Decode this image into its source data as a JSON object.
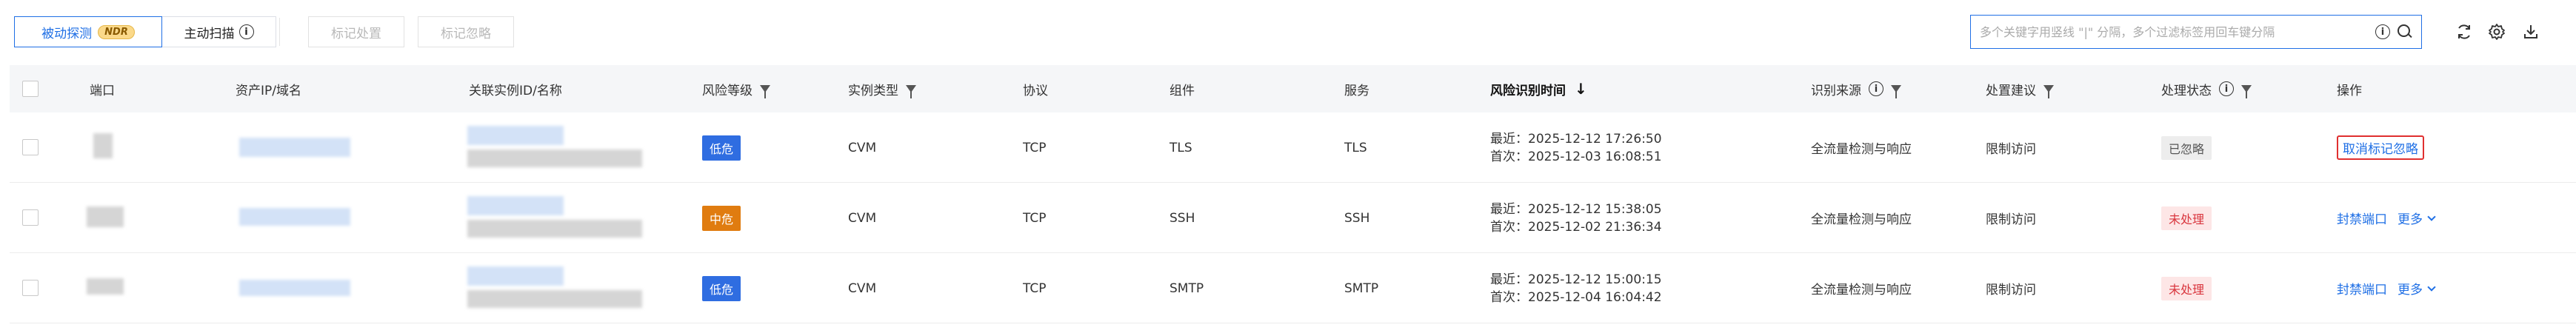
{
  "toolbar": {
    "tab_passive": "被动探测",
    "tab_passive_badge": "NDR",
    "tab_active": "主动扫描",
    "btn_mark_handle": "标记处置",
    "btn_mark_ignore": "标记忽略",
    "search_placeholder": "多个关键字用竖线 \"|\" 分隔，多个过滤标签用回车键分隔",
    "icons": [
      "info-icon",
      "search-icon",
      "refresh-icon",
      "gear-icon",
      "download-icon"
    ]
  },
  "table": {
    "columns": {
      "port": "端口",
      "asset": "资产IP/域名",
      "instance": "关联实例ID/名称",
      "risk": "风险等级",
      "instance_type": "实例类型",
      "protocol": "协议",
      "component": "组件",
      "service": "服务",
      "time": "风险识别时间",
      "source": "识别来源",
      "suggestion": "处置建议",
      "status": "处理状态",
      "action": "操作"
    },
    "rows": [
      {
        "risk": "低危",
        "instance_type": "CVM",
        "protocol": "TCP",
        "component": "TLS",
        "service": "TLS",
        "time_recent": "最近：2025-12-12 17:26:50",
        "time_first": "首次：2025-12-03 16:08:51",
        "source": "全流量检测与响应",
        "suggestion": "限制访问",
        "status": "已忽略",
        "action_primary": "取消标记忽略",
        "action_more": ""
      },
      {
        "risk": "中危",
        "instance_type": "CVM",
        "protocol": "TCP",
        "component": "SSH",
        "service": "SSH",
        "time_recent": "最近：2025-12-12 15:38:05",
        "time_first": "首次：2025-12-02 21:36:34",
        "source": "全流量检测与响应",
        "suggestion": "限制访问",
        "status": "未处理",
        "action_primary": "封禁端口",
        "action_more": "更多"
      },
      {
        "risk": "低危",
        "instance_type": "CVM",
        "protocol": "TCP",
        "component": "SMTP",
        "service": "SMTP",
        "time_recent": "最近：2025-12-12 15:00:15",
        "time_first": "首次：2025-12-04 16:04:42",
        "source": "全流量检测与响应",
        "suggestion": "限制访问",
        "status": "未处理",
        "action_primary": "封禁端口",
        "action_more": "更多"
      }
    ]
  },
  "colors": {
    "accent": "#1f6fe5",
    "risk_low": "#2f6de1",
    "risk_medium": "#e07c10",
    "status_pending": "#d9363e",
    "highlight_border": "#e03030"
  }
}
